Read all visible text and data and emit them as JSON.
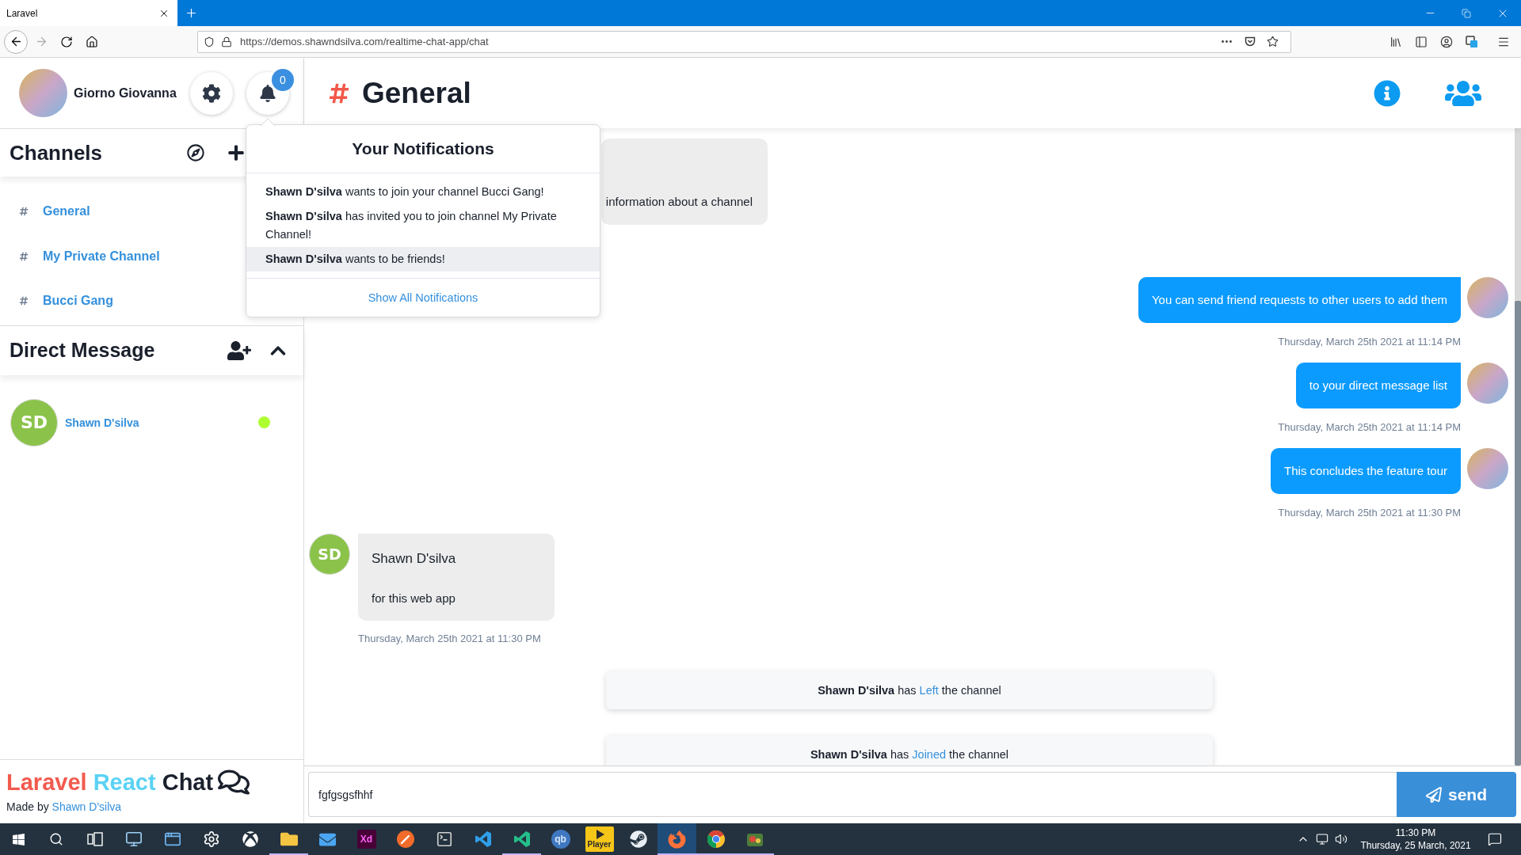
{
  "browser": {
    "tab": {
      "title": "Laravel",
      "selected": true
    },
    "url": "https://demos.shawndsilva.com/realtime-chat-app/chat"
  },
  "user": {
    "name": "Giorno Giovanna",
    "unread_count": "0"
  },
  "channels": {
    "title": "Channels",
    "items": [
      {
        "name": "General"
      },
      {
        "name": "My Private Channel"
      },
      {
        "name": "Bucci Gang"
      }
    ]
  },
  "direct_messages": {
    "title": "Direct Message",
    "expanded": true,
    "contacts": [
      {
        "initials": "SD",
        "name": "Shawn D'silva",
        "online": true
      }
    ]
  },
  "brand": {
    "words": [
      {
        "text": "Laravel",
        "color": "#f25a4e"
      },
      {
        "text": "React",
        "color": "#5ad2f4"
      },
      {
        "text": "Chat",
        "color": "#1a202c"
      }
    ],
    "credit": "Made by",
    "author": "Shawn D'silva"
  },
  "channel_header": {
    "title": "General"
  },
  "notifications": {
    "title": "Your Notifications",
    "items": [
      {
        "text": "**Shawn D'silva** wants to join your channel Bucci Gang!",
        "selected": false
      },
      {
        "text": "**Shawn D'silva** has invited you to join channel My Private Channel!",
        "selected": false
      },
      {
        "text": "**Shawn D'silva** wants to be friends!",
        "selected": true
      }
    ],
    "footer_link": "Show All Notifications"
  },
  "messages": [
    {
      "kind": "received",
      "text": "information about a channel"
    },
    {
      "kind": "sent",
      "text": "You can send friend requests to other users to add them",
      "time": "Thursday, March 25th 2021 at 11:14 PM"
    },
    {
      "kind": "sent",
      "text": "to your direct message list",
      "time": "Thursday, March 25th 2021 at 11:14 PM"
    },
    {
      "kind": "sent",
      "text": "This concludes the feature tour",
      "time": "Thursday, March 25th 2021 at 11:30 PM"
    },
    {
      "kind": "received",
      "sender": "Shawn D'silva",
      "initials": "SD",
      "text": "for this web app",
      "time": "Thursday, March 25th 2021 at 11:30 PM"
    },
    {
      "kind": "event",
      "actor": "Shawn D'silva",
      "verb": "has",
      "action": "Left",
      "object": "the channel"
    },
    {
      "kind": "event",
      "actor": "Shawn D'silva",
      "verb": "has",
      "action": "Joined",
      "object": "the channel"
    }
  ],
  "composer": {
    "value": "fgfgsgsfhhf",
    "button": "send"
  },
  "taskbar": {
    "apps": [
      {
        "kind": "monitor",
        "open": false,
        "selected": false
      },
      {
        "kind": "window",
        "open": false,
        "selected": false
      },
      {
        "kind": "settings",
        "open": false,
        "selected": false
      },
      {
        "kind": "xbox",
        "open": false,
        "selected": false
      },
      {
        "kind": "folder",
        "open": true,
        "selected": false
      },
      {
        "kind": "mail",
        "open": false,
        "selected": false
      },
      {
        "kind": "xd",
        "label": "Xd",
        "open": false,
        "selected": false
      },
      {
        "kind": "pen",
        "open": false,
        "selected": false
      },
      {
        "kind": "terminal",
        "open": false,
        "selected": false
      },
      {
        "kind": "code",
        "open": false,
        "selected": false
      },
      {
        "kind": "code-alt",
        "open": true,
        "selected": false
      },
      {
        "kind": "qb",
        "label": "qb",
        "open": false,
        "selected": false
      },
      {
        "kind": "player",
        "label": "Player",
        "open": false,
        "selected": false
      },
      {
        "kind": "steam",
        "open": false,
        "selected": false
      },
      {
        "kind": "firefox",
        "open": true,
        "selected": true
      },
      {
        "kind": "chrome",
        "open": true,
        "selected": false
      },
      {
        "kind": "game",
        "open": true,
        "selected": false
      }
    ],
    "time": "11:30 PM",
    "date": "Thursday, 25 March, 2021"
  }
}
